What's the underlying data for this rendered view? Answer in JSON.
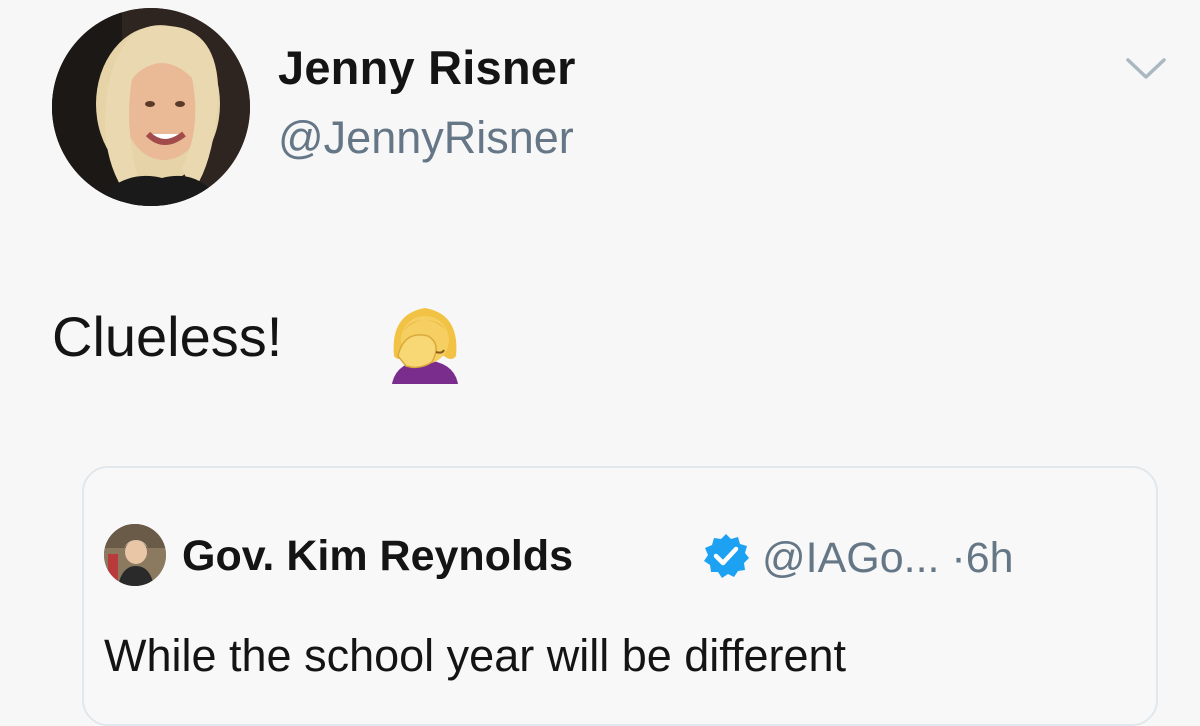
{
  "tweet": {
    "author": {
      "display_name": "Jenny Risner",
      "handle": "@JennyRisner",
      "avatar_icon": "profile-photo"
    },
    "menu_icon": "chevron-down-icon",
    "text": "Clueless!",
    "emoji_icon": "woman-facepalming-emoji"
  },
  "quoted_tweet": {
    "author": {
      "display_name": "Gov. Kim Reynolds",
      "verified_icon": "verified-badge-icon",
      "handle_and_time": "@IAGo... ·6h",
      "avatar_icon": "profile-photo"
    },
    "text": "While the school year will be different"
  },
  "colors": {
    "background": "#f7f7f7",
    "text_primary": "#141414",
    "text_secondary": "#657786",
    "verified_blue": "#1da1f2",
    "card_border": "#e1e8ed"
  }
}
